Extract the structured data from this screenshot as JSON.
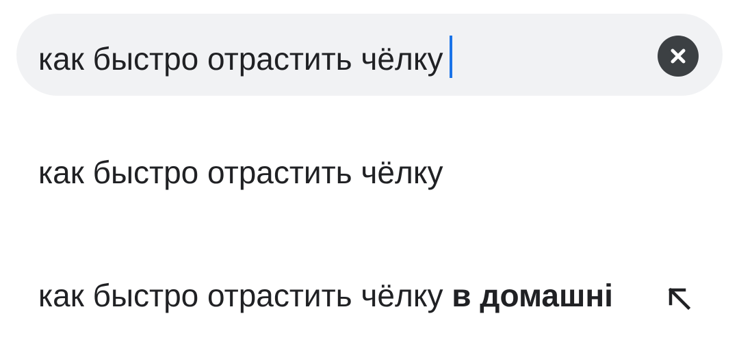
{
  "search": {
    "query": "как быстро отрастить чёлку",
    "clear_icon": "close-icon"
  },
  "suggestions": [
    {
      "text": "как быстро отрастить чёлку",
      "completion": ""
    },
    {
      "text": "как быстро отрастить чёлку ",
      "completion": "в домашні",
      "action_icon": "arrow-up-left-icon"
    }
  ],
  "colors": {
    "search_bg": "#f1f2f4",
    "caret": "#1a73e8",
    "clear_button_bg": "#3c4043",
    "text": "#202124"
  }
}
